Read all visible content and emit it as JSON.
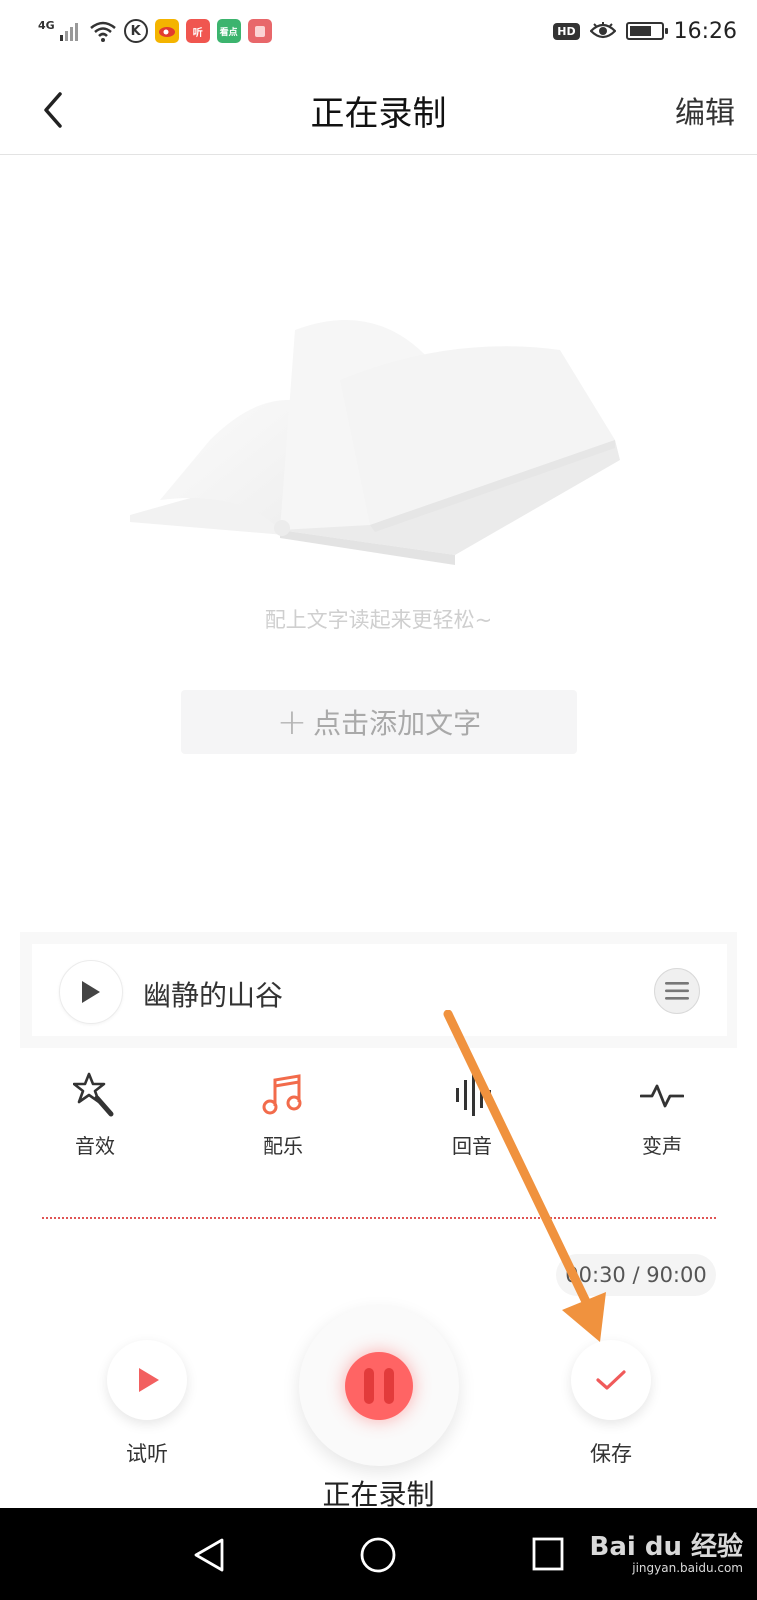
{
  "status_bar": {
    "network_label": "4G",
    "app_badges": [
      {
        "name": "k-app-icon",
        "text": "K",
        "color": "#333333"
      },
      {
        "name": "weibo-icon",
        "text": "",
        "color": "#f4b400"
      },
      {
        "name": "ting-icon",
        "text": "听",
        "color": "#f0564f"
      },
      {
        "name": "kandian-icon",
        "text": "看点",
        "color": "#3cb46e"
      },
      {
        "name": "app-red-icon",
        "text": "",
        "color": "#e8676a"
      }
    ],
    "hd_label": "HD",
    "battery_level": 0.7,
    "time": "16:26"
  },
  "header": {
    "title": "正在录制",
    "edit_label": "编辑"
  },
  "content": {
    "hint": "配上文字读起来更轻松~",
    "add_text_label": "点击添加文字",
    "add_icon": "+"
  },
  "music": {
    "name": "幽静的山谷"
  },
  "tools": [
    {
      "label": "音效",
      "icon": "magic-wand-icon"
    },
    {
      "label": "配乐",
      "icon": "music-note-icon"
    },
    {
      "label": "回音",
      "icon": "waveform-icon"
    },
    {
      "label": "变声",
      "icon": "pulse-icon"
    }
  ],
  "timer": "00:30 / 90:00",
  "controls": {
    "listen_label": "试听",
    "save_label": "保存",
    "recording_label": "正在录制"
  },
  "watermark": {
    "logo": "Bai  du 经验",
    "url": "jingyan.baidu.com"
  },
  "colors": {
    "accent": "#ff5a5a",
    "music_icon": "#f26b4b",
    "annotation_arrow": "#f0923e"
  }
}
